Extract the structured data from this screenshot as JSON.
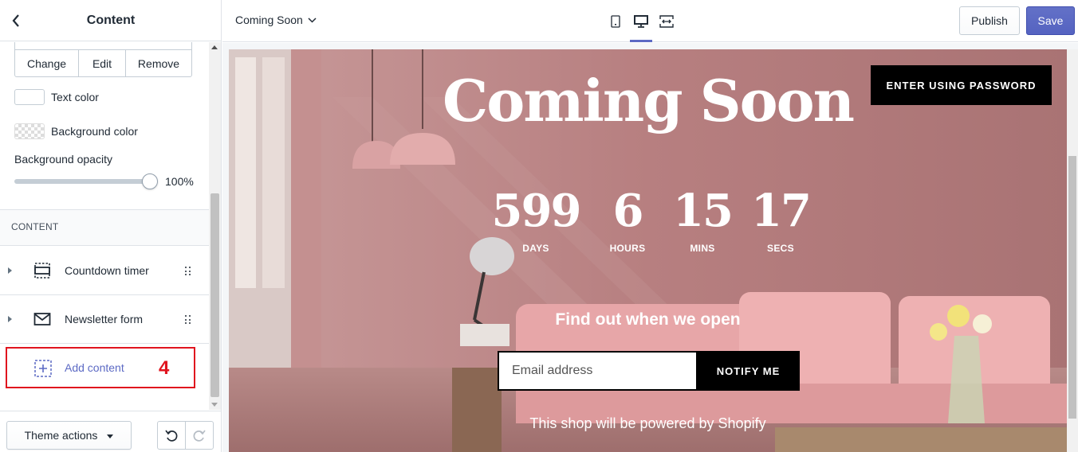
{
  "sidebar": {
    "title": "Content",
    "image_actions": {
      "change": "Change",
      "edit": "Edit",
      "remove": "Remove"
    },
    "text_color_label": "Text color",
    "background_color_label": "Background color",
    "opacity_label": "Background opacity",
    "opacity_value": "100%",
    "opacity_fraction": 1.0,
    "section_label": "CONTENT",
    "blocks": [
      {
        "label": "Countdown timer",
        "icon": "countdown-icon"
      },
      {
        "label": "Newsletter form",
        "icon": "envelope-icon"
      }
    ],
    "add_content_label": "Add content",
    "step_number": "4",
    "theme_actions_label": "Theme actions"
  },
  "topbar": {
    "page_name": "Coming Soon",
    "publish_label": "Publish",
    "save_label": "Save",
    "devices": [
      "mobile-icon",
      "desktop-icon",
      "fullscreen-icon"
    ],
    "active_device": "desktop-icon"
  },
  "preview": {
    "title": "Coming Soon",
    "password_button": "ENTER USING PASSWORD",
    "countdown": [
      {
        "value": "599",
        "label": "DAYS"
      },
      {
        "value": "6",
        "label": "HOURS"
      },
      {
        "value": "15",
        "label": "MINS"
      },
      {
        "value": "17",
        "label": "SECS"
      }
    ],
    "heading": "Find out when we open",
    "email_placeholder": "Email address",
    "notify_button": "NOTIFY ME",
    "powered_by": "This shop will be powered by Shopify"
  },
  "colors": {
    "accent": "#5c6ac4",
    "highlight": "#e0141e",
    "preview_bg": "#b98686"
  }
}
